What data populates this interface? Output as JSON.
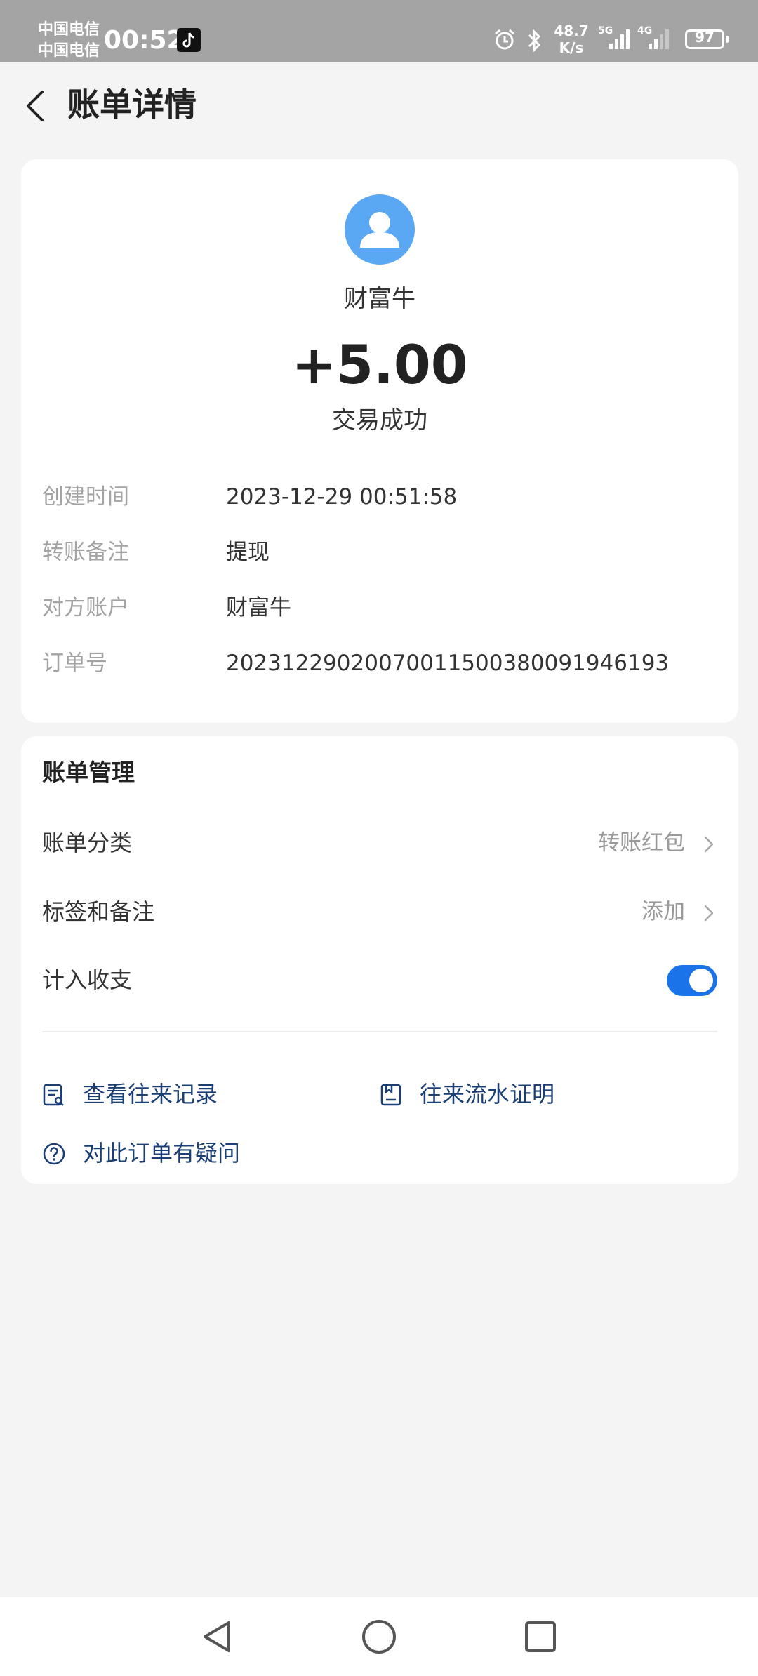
{
  "status_bar": {
    "carrier_1": "中国电信",
    "carrier_2": "中国电信",
    "time": "00:52",
    "net_speed_value": "48.7",
    "net_speed_unit": "K/s",
    "signal_1_label": "5G",
    "signal_2_label": "4G",
    "battery": "97"
  },
  "header": {
    "title": "账单详情"
  },
  "summary": {
    "payee_name": "财富牛",
    "amount": "+5.00",
    "status": "交易成功"
  },
  "details": [
    {
      "label": "创建时间",
      "value": "2023-12-29 00:51:58"
    },
    {
      "label": "转账备注",
      "value": "提现"
    },
    {
      "label": "对方账户",
      "value": "财富牛"
    },
    {
      "label": "订单号",
      "value": "20231229020070011500380091946193"
    }
  ],
  "management": {
    "title": "账单管理",
    "category_label": "账单分类",
    "category_value": "转账红包",
    "tags_label": "标签和备注",
    "tags_value": "添加",
    "include_label": "计入收支",
    "include_enabled": true,
    "links": {
      "history": "查看往来记录",
      "proof": "往来流水证明",
      "question": "对此订单有疑问"
    }
  },
  "colors": {
    "accent": "#1a73e8",
    "link": "#1b3f74",
    "avatar": "#5aa8f3"
  }
}
